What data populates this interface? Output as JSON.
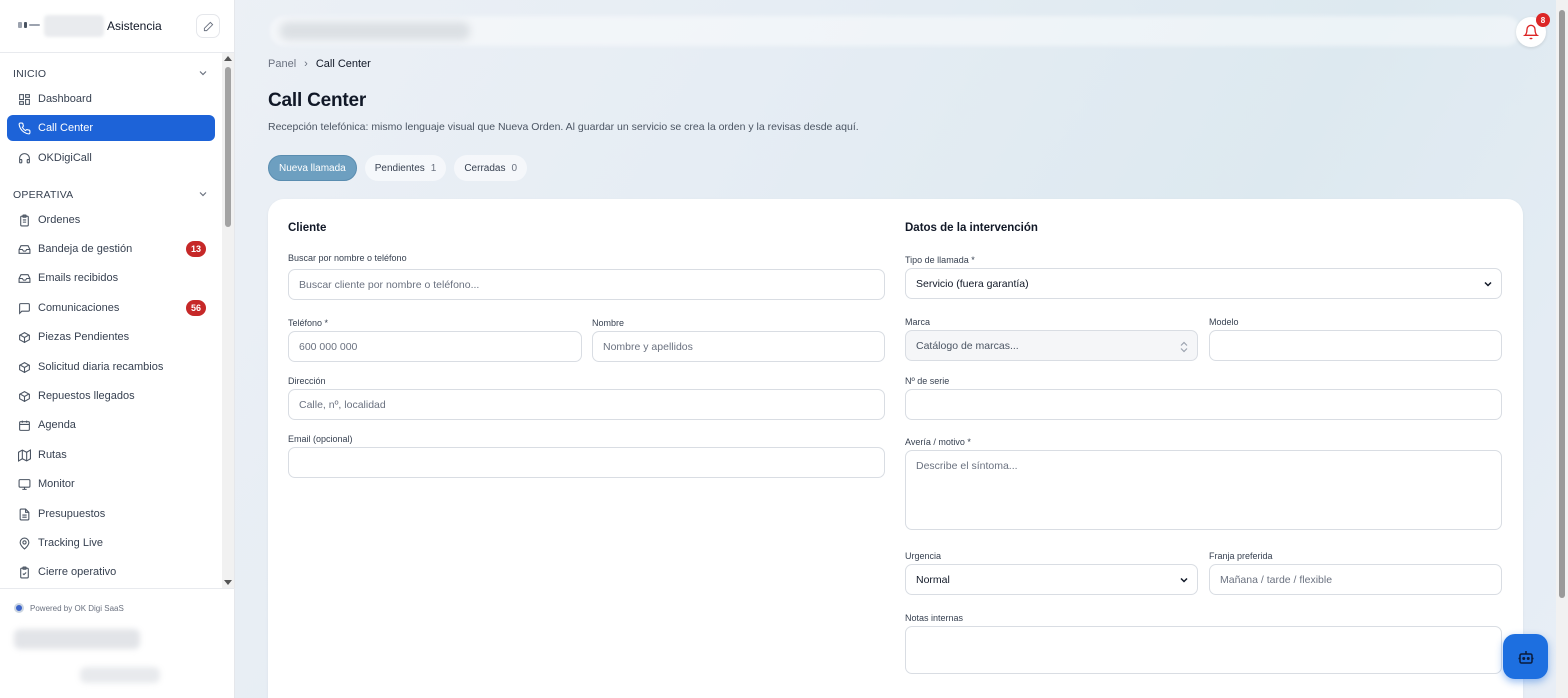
{
  "sidebar": {
    "brand_name": "Asistencia",
    "sections": [
      {
        "title": "INICIO"
      },
      {
        "title": "OPERATIVA"
      }
    ],
    "items": [
      {
        "label": "Dashboard",
        "icon": "dashboard-icon"
      },
      {
        "label": "Call Center",
        "icon": "phone-icon",
        "active": true
      },
      {
        "label": "OKDigiCall",
        "icon": "headset-icon"
      },
      {
        "label": "Ordenes",
        "icon": "clipboard-icon"
      },
      {
        "label": "Bandeja de gestión",
        "icon": "inbox-icon",
        "badge": "13"
      },
      {
        "label": "Emails recibidos",
        "icon": "mail-inbox-icon"
      },
      {
        "label": "Comunicaciones",
        "icon": "message-icon",
        "badge": "56"
      },
      {
        "label": "Piezas Pendientes",
        "icon": "package-icon"
      },
      {
        "label": "Solicitud diaria recambios",
        "icon": "package-icon"
      },
      {
        "label": "Repuestos llegados",
        "icon": "package-icon"
      },
      {
        "label": "Agenda",
        "icon": "calendar-icon"
      },
      {
        "label": "Rutas",
        "icon": "map-icon"
      },
      {
        "label": "Monitor",
        "icon": "monitor-icon"
      },
      {
        "label": "Presupuestos",
        "icon": "document-icon"
      },
      {
        "label": "Tracking Live",
        "icon": "map-pin-icon"
      },
      {
        "label": "Cierre operativo",
        "icon": "clipboard-check-icon"
      }
    ],
    "powered_by": "Powered by OK Digi SaaS"
  },
  "header": {
    "notification_count": "8"
  },
  "breadcrumb": {
    "root": "Panel",
    "separator": "›",
    "current": "Call Center"
  },
  "page": {
    "title": "Call Center",
    "subtitle": "Recepción telefónica: mismo lenguaje visual que Nueva Orden. Al guardar un servicio se crea la orden y la revisas desde aquí."
  },
  "tabs": [
    {
      "label": "Nueva llamada",
      "active": true
    },
    {
      "label": "Pendientes",
      "count": "1"
    },
    {
      "label": "Cerradas",
      "count": "0"
    }
  ],
  "cliente": {
    "heading": "Cliente",
    "search_label": "Buscar por nombre o teléfono",
    "search_placeholder": "Buscar cliente por nombre o teléfono...",
    "telefono_label": "Teléfono *",
    "telefono_placeholder": "600 000 000",
    "nombre_label": "Nombre",
    "nombre_placeholder": "Nombre y apellidos",
    "direccion_label": "Dirección",
    "direccion_placeholder": "Calle, nº, localidad",
    "email_label": "Email (opcional)",
    "email_value": ""
  },
  "intervencion": {
    "heading": "Datos de la intervención",
    "tipo_label": "Tipo de llamada *",
    "tipo_value": "Servicio (fuera garantía)",
    "marca_label": "Marca",
    "marca_value": "Catálogo de marcas...",
    "modelo_label": "Modelo",
    "modelo_value": "",
    "serie_label": "Nº de serie",
    "serie_value": "",
    "averia_label": "Avería / motivo *",
    "averia_placeholder": "Describe el síntoma...",
    "urgencia_label": "Urgencia",
    "urgencia_value": "Normal",
    "franja_label": "Franja preferida",
    "franja_placeholder": "Mañana / tarde / flexible",
    "notas_label": "Notas internas",
    "notas_value": ""
  },
  "colors": {
    "accent": "#1d63d8",
    "badge": "#c62828",
    "tab_active": "#6d9fc0"
  }
}
